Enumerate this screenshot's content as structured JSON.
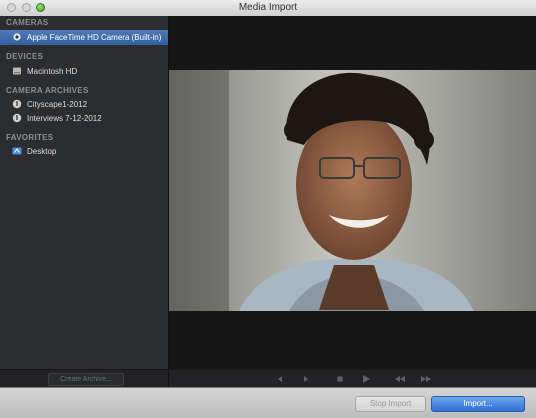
{
  "window": {
    "title": "Media Import"
  },
  "sidebar": {
    "sections": [
      {
        "heading": "CAMERAS",
        "items": [
          {
            "label": "Apple FaceTime HD Camera (Built-in)",
            "icon": "camera-icon",
            "selected": true
          }
        ]
      },
      {
        "heading": "DEVICES",
        "items": [
          {
            "label": "Macintosh HD",
            "icon": "hard-drive-icon"
          }
        ]
      },
      {
        "heading": "CAMERA ARCHIVES",
        "items": [
          {
            "label": "Cityscape1-2012",
            "icon": "archive-icon"
          },
          {
            "label": "Interviews 7-12-2012",
            "icon": "archive-icon"
          }
        ]
      },
      {
        "heading": "FAVORITES",
        "items": [
          {
            "label": "Desktop",
            "icon": "desktop-folder-icon"
          }
        ]
      }
    ],
    "create_archive_label": "Create Archive..."
  },
  "viewer": {
    "content": "live camera preview"
  },
  "transport": {
    "buttons": [
      "previous-icon",
      "play-icon",
      "stop-icon",
      "play-icon",
      "rewind-icon",
      "fast-forward-icon"
    ]
  },
  "footer": {
    "stop_import_label": "Stop Import",
    "import_label": "Import..."
  },
  "colors": {
    "selection": "#34609f",
    "import_button": "#2f6fd3"
  }
}
